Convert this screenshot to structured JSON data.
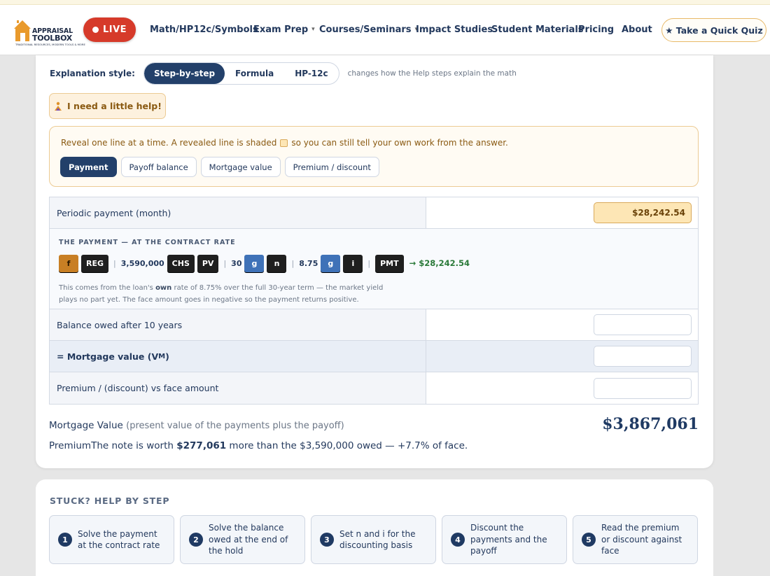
{
  "nav": {
    "logo_line1": "APPRAISAL",
    "logo_line2": "TOOLBOX",
    "logo_tagline": "TRADITIONAL RESOURCES, MODERN TOOLS & MORE",
    "live_label": "LIVE",
    "links": [
      {
        "label": "Math/HP12c/Symbols",
        "dropdown": false
      },
      {
        "label": "Exam Prep",
        "dropdown": true
      },
      {
        "label": "Courses/Seminars",
        "dropdown": true
      },
      {
        "label": "Impact Studies",
        "dropdown": false
      },
      {
        "label": "Student Materials",
        "dropdown": false
      },
      {
        "label": "Pricing",
        "dropdown": false
      },
      {
        "label": "About",
        "dropdown": false
      }
    ],
    "quiz_label": "★ Take a Quick Quiz"
  },
  "explanation": {
    "label": "Explanation style:",
    "options": [
      "Step-by-step",
      "Formula",
      "HP-12c"
    ],
    "selected": "Step-by-step",
    "note": "changes how the Help steps explain the math"
  },
  "help_button": "I need a little help!",
  "reveal": {
    "text_before": "Reveal one line at a time. A revealed line is shaded",
    "text_after": "so you can still tell your own work from the answer.",
    "tabs": [
      "Payment",
      "Payoff balance",
      "Mortgage value",
      "Premium / discount"
    ],
    "selected": "Payment"
  },
  "table": {
    "payment_label": "Periodic payment (month)",
    "payment_value": "$28,242.54",
    "explain_heading": "THE PAYMENT — AT THE CONTRACT RATE",
    "keys": {
      "f": "f",
      "reg": "REG",
      "pv_amount": "3,590,000",
      "chs": "CHS",
      "pv": "PV",
      "n_years": "30",
      "g1": "g",
      "n": "n",
      "rate": "8.75",
      "g2": "g",
      "i": "i",
      "pmt": "PMT",
      "result": "→ $28,242.54"
    },
    "note_part1": "This comes from the loan's ",
    "note_bold": "own",
    "note_part2": " rate of 8.75% over the full 30-year term — the market yield plays no part yet. The face amount goes in negative so the payment returns positive.",
    "balance_label": "Balance owed after 10 years",
    "mortgage_label_prefix": "= Mortgage value (V",
    "mortgage_label_sub": "M",
    "mortgage_label_suffix": ")",
    "premium_label": "Premium / (discount) vs face amount"
  },
  "summary": {
    "mv_label": "Mortgage Value",
    "mv_sub": "(present value of the payments plus the payoff)",
    "mv_amount": "$3,867,061",
    "premium_prefix": "PremiumThe note is worth ",
    "premium_amount": "$277,061",
    "premium_suffix": " more than the $3,590,000 owed — +7.7% of face."
  },
  "stuck": {
    "heading": "STUCK? HELP BY STEP",
    "steps": [
      {
        "num": "1",
        "text": "Solve the payment at the contract rate"
      },
      {
        "num": "2",
        "text": "Solve the balance owed at the end of the hold"
      },
      {
        "num": "3",
        "text": "Set n and i for the discounting basis"
      },
      {
        "num": "4",
        "text": "Discount the payments and the payoff"
      },
      {
        "num": "5",
        "text": "Read the premium or discount against face"
      }
    ]
  },
  "colors": {
    "navy": "#23406a",
    "live_red": "#d63a2a",
    "gold_border": "#eccb94",
    "revealed_fill": "#fde6b5",
    "result_green": "#2b7a3a",
    "g_key_blue": "#3f72b8",
    "f_key_orange": "#c87f24"
  }
}
